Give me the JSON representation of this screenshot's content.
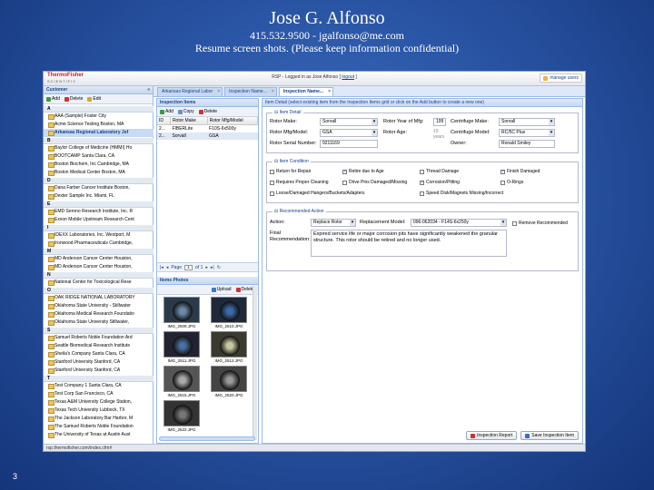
{
  "header": {
    "name": "Jose G. Alfonso",
    "contact": "415.532.9500 - jgalfonso@me.com",
    "subtitle": "Resume screen shots. (Please keep information confidential)"
  },
  "slide_number": "3",
  "app": {
    "logo_top": "ThermoFisher",
    "logo_bottom": "SCIENTIFIC",
    "login_text": "RSP - Logged in as Jose Alfonso [",
    "logout": "logout",
    "login_end": "]",
    "manage_users": "manage users",
    "status_url": "rsp.thermofisher.com/index.cfm#"
  },
  "customer": {
    "title": "Customer",
    "collapse": "«",
    "toolbar": {
      "add": "Add",
      "delete": "Delete",
      "edit": "Edit"
    },
    "groups": [
      {
        "letter": "A",
        "items": [
          "AAA (Sample) Foster City",
          "Acme Science Testing Boston, MA",
          "Arkansas Regional Laboratory Jef"
        ]
      },
      {
        "letter": "B",
        "items": [
          "Baylor College of Medicine (HMMI) Ho",
          "BOOTCAMP Santa Clara, CA",
          "Boston Biochem, Inc Cambridge, MA",
          "Boston Medical Center Boston, MA"
        ]
      },
      {
        "letter": "D",
        "items": [
          "Dana Farber Cancer Institute Boston,",
          "Dexter Sample Inc. Miami, FL"
        ]
      },
      {
        "letter": "E",
        "items": [
          "EMD Serono Research Institute, Inc. R",
          "Exxon Mobile Upstream Research Cent"
        ]
      },
      {
        "letter": "I",
        "items": [
          "IDEXX Laboratories, Inc. Westport, M",
          "Ironwood Pharmaceuticals Cambridge,"
        ]
      },
      {
        "letter": "M",
        "items": [
          "MD Anderson Cancer Center Houston,",
          "MD Anderson Cancer Center Houston,"
        ]
      },
      {
        "letter": "N",
        "items": [
          "National Center for Toxicological Rese"
        ]
      },
      {
        "letter": "O",
        "items": [
          "OAK RIDGE NATIONAL LABORATORY",
          "Oklahoma State University - Stillwater",
          "Oklahoma Medical Research Foundatio",
          "Oklahoma State University Stillwater,"
        ]
      },
      {
        "letter": "S",
        "items": [
          "Samuel Roberts Noble Foundation Ard",
          "Seattle Biomedical Research Institute",
          "Sheila's Company Santa Clara, CA",
          "Stanford University Stanford, CA",
          "Stanford University Stanford, CA"
        ]
      },
      {
        "letter": "T",
        "items": [
          "Test Company 1 Santa Clara, CA",
          "Test Corp San Francisco, CA",
          "Texas A&M University College Station,",
          "Texas Tech University Lubbock, TX",
          "The Jackson Laboratory Bar Harbor, M",
          "The Samuel Roberts Noble Foundation",
          "The University of Texas at Austin Aust"
        ]
      }
    ]
  },
  "tabs": [
    "Arkansas Regional Labor",
    "Inspection Name...",
    "Inspection Name..."
  ],
  "inspection_items": {
    "title": "Inspection Items",
    "toolbar": {
      "add": "Add",
      "copy": "Copy",
      "delete": "Delete"
    },
    "columns": [
      "ID",
      "Rotor Make",
      "Rotor Mfg/Model"
    ],
    "rows": [
      [
        "2...",
        "FIBERLite",
        "F10S-6x500y"
      ],
      [
        "2...",
        "Sorvall",
        "GSA"
      ]
    ],
    "pager": {
      "page_label": "Page",
      "page": "1",
      "of": "of 1"
    }
  },
  "photos": {
    "title": "Items Photos",
    "toolbar": {
      "upload": "Upload",
      "delete": "Delete"
    },
    "items": [
      "IMG_2509.JPG",
      "IMG_2510.JPG",
      "IMG_2511.JPG",
      "IMG_2512.JPG",
      "IMG_2515.JPG",
      "IMG_2520.JPG",
      "IMG_2522.JPG"
    ]
  },
  "detail": {
    "title": "Item Detail (select existing item from the Inspection Items grid or click on the Add button to create a new one)",
    "item_detail": {
      "legend": "Item Detail",
      "rotor_make_label": "Rotor Make:",
      "rotor_make": "Sorvall",
      "rotor_model_label": "Rotor Mfg/Model:",
      "rotor_model": "GSA",
      "serial_label": "Rotor Serial Number:",
      "serial": "9211169",
      "year_label": "Rotor Year of Mfg:",
      "year": "199",
      "age_label": "Rotor Age:",
      "age": "19 years",
      "cf_make_label": "Centrifuge Make:",
      "cf_make": "Sorvall",
      "cf_model_label": "Centrifuge Model:",
      "cf_model": "RC/5C Plus",
      "owner_label": "Owner:",
      "owner": "Ronald Smiley"
    },
    "condition": {
      "legend": "Item Condition",
      "checks": [
        {
          "label": "Return for Repair",
          "checked": false
        },
        {
          "label": "Retire due to Age",
          "checked": true
        },
        {
          "label": "Thread Damage",
          "checked": false
        },
        {
          "label": "Finish Damaged",
          "checked": true
        },
        {
          "label": "Requires Proper Cleaning",
          "checked": false
        },
        {
          "label": "Drive Pins Damaged/Missing",
          "checked": false
        },
        {
          "label": "Corrosion/Pitting",
          "checked": true
        },
        {
          "label": "O-Rings",
          "checked": false
        },
        {
          "label": "Loose/Damaged Hangers/Buckets/Adapters",
          "checked": false
        },
        {
          "label": "Speed Disk/Magnets Missing/Incorrect",
          "checked": false
        }
      ]
    },
    "action": {
      "legend": "Recommended Action",
      "action_label": "Action:",
      "action": "Replace Rotor",
      "model_label": "Replacement Model:",
      "model": "096-062034 - F14S-6x250y",
      "remove_label": "Remove Recommended",
      "final_label": "Final Recommendation:",
      "final_text": "Expired service life or major corrosion pits have significantly weakened the granular structure. This rotor should be retired and no longer used."
    },
    "buttons": {
      "report": "Inspection Report",
      "save": "Save Inspection Item"
    }
  }
}
